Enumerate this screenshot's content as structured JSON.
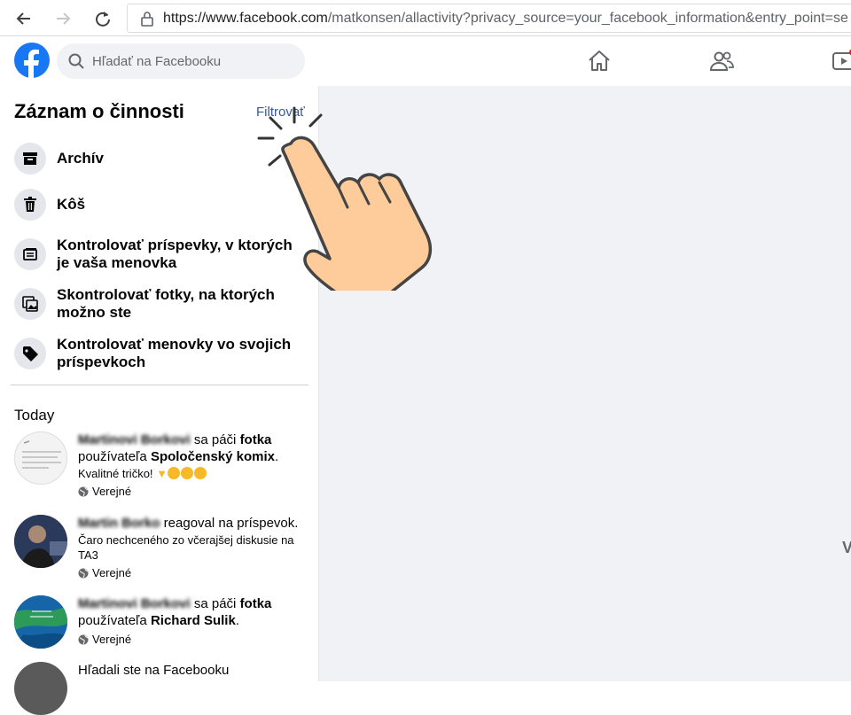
{
  "browser": {
    "url_host": "https://www.facebook.com",
    "url_path": "/matkonsen/allactivity?privacy_source=your_facebook_information&entry_point=se"
  },
  "header": {
    "search_placeholder": "Hľadať na Facebooku",
    "icons": [
      "facebook-logo",
      "home-icon",
      "friends-icon",
      "watch-icon"
    ],
    "brand_color": "#1877f2"
  },
  "sidebar": {
    "title": "Záznam o činnosti",
    "filter_label": "Filtrovať",
    "items": [
      {
        "label": "Archív",
        "icon": "archive-icon"
      },
      {
        "label": "Kôš",
        "icon": "trash-icon"
      },
      {
        "label": "Kontrolovať príspevky, v ktorých je vaša menovka",
        "icon": "posts-icon"
      },
      {
        "label": "Skontrolovať fotky, na ktorých možno ste",
        "icon": "photos-icon"
      },
      {
        "label": "Kontrolovať menovky vo svojich príspevkoch",
        "icon": "tag-icon"
      }
    ]
  },
  "activity": {
    "section_title": "Today",
    "entries": [
      {
        "name": "Martinovi Borkovi",
        "action": " sa páči ",
        "object": "fotka",
        "line2_prefix": "používateľa ",
        "line2_object": "Spoločenský komix",
        "line2_suffix": ".",
        "quote": "Kvalitné tričko!",
        "privacy": "Verejné"
      },
      {
        "name": "Martin Borko",
        "action": " reagoval na príspevok.",
        "quote": "Čaro nechceného zo včerajšej diskusie na TA3",
        "privacy": "Verejné"
      },
      {
        "name": "Martinovi Borkovi",
        "action": " sa páči ",
        "object": "fotka",
        "line2_prefix": "používateľa ",
        "line2_object": "Richard Sulik",
        "line2_suffix": ".",
        "privacy": "Verejné"
      },
      {
        "text": "Hľadali ste na Facebooku"
      }
    ]
  },
  "main": {
    "edge_letter": "V"
  }
}
